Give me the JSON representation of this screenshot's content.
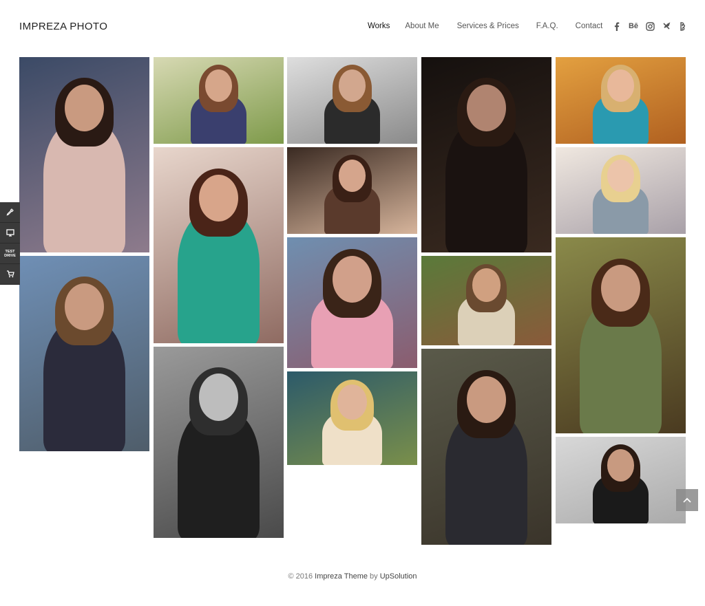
{
  "header": {
    "logo": "IMPREZA PHOTO",
    "nav": [
      {
        "label": "Works",
        "active": true
      },
      {
        "label": "About Me",
        "active": false
      },
      {
        "label": "Services & Prices",
        "active": false
      },
      {
        "label": "F.A.Q.",
        "active": false
      },
      {
        "label": "Contact",
        "active": false
      }
    ],
    "socials": [
      "facebook-icon",
      "behance-icon",
      "instagram-icon",
      "tripadvisor-icon",
      "vk-icon"
    ],
    "behance_text": "Bē"
  },
  "side_panel": {
    "items": [
      "eyedropper-icon",
      "monitor-icon",
      "test-drive-label",
      "cart-icon"
    ],
    "test_drive_line1": "TEST",
    "test_drive_line2": "DRIVE"
  },
  "gallery": {
    "tiles": [
      {
        "name": "portrait-woman-dark-hair-dress",
        "col": 0,
        "bg": [
          "#3b4a66",
          "#8e7b8c"
        ],
        "skin": "#c99a80",
        "hair": "#2a1a14",
        "cloth": "#d8b8b0"
      },
      {
        "name": "woman-city-skyscraper",
        "col": 0,
        "bg": [
          "#6f8fb5",
          "#4f5d6a"
        ],
        "skin": "#c99a80",
        "hair": "#6b4a2e",
        "cloth": "#2b2b3b"
      },
      {
        "name": "woman-polka-dress-garden",
        "col": 1,
        "bg": [
          "#d7d9b3",
          "#7e9a4a"
        ],
        "skin": "#d6a68a",
        "hair": "#7a4a30",
        "cloth": "#3a3f6e"
      },
      {
        "name": "woman-teal-jacket",
        "col": 1,
        "bg": [
          "#e8d6cc",
          "#8f6b62"
        ],
        "skin": "#d8a58a",
        "hair": "#4a2418",
        "cloth": "#27a38c"
      },
      {
        "name": "woman-bw-polka-dress",
        "col": 1,
        "bg": [
          "#9a9a9a",
          "#4a4a4a"
        ],
        "skin": "#bdbdbd",
        "hair": "#2e2e2e",
        "cloth": "#1f1f1f"
      },
      {
        "name": "woman-short-hair-closeup",
        "col": 2,
        "bg": [
          "#dedede",
          "#8a8a8a"
        ],
        "skin": "#d2a78e",
        "hair": "#8a5a34",
        "cloth": "#2b2b2b"
      },
      {
        "name": "woman-lollipop-closeup",
        "col": 2,
        "bg": [
          "#3a2a22",
          "#d7b59c"
        ],
        "skin": "#d5a58c",
        "hair": "#3a2016",
        "cloth": "#5a3a2c"
      },
      {
        "name": "woman-striped-shirt-graffiti",
        "col": 2,
        "bg": [
          "#6f8fb0",
          "#8b5c6e"
        ],
        "skin": "#d1a08a",
        "hair": "#3a2418",
        "cloth": "#e8a0b4"
      },
      {
        "name": "woman-blonde-meadow",
        "col": 2,
        "bg": [
          "#2c5a6a",
          "#7a8f4a"
        ],
        "skin": "#e0b49a",
        "hair": "#e0c070",
        "cloth": "#efe0c8"
      },
      {
        "name": "woman-portrait-dark-vintage",
        "col": 3,
        "bg": [
          "#15100e",
          "#3a2a20"
        ],
        "skin": "#b08470",
        "hair": "#2a1a12",
        "cloth": "#1a1210"
      },
      {
        "name": "woman-bridge-lake",
        "col": 3,
        "bg": [
          "#5a7a3a",
          "#8a5a3a"
        ],
        "skin": "#d0a080",
        "hair": "#6a4a30",
        "cloth": "#dcd0b8"
      },
      {
        "name": "woman-motorcycle",
        "col": 3,
        "bg": [
          "#5a5a4a",
          "#3a342a"
        ],
        "skin": "#c99a80",
        "hair": "#2a1a12",
        "cloth": "#2a2a30"
      },
      {
        "name": "woman-blonde-lollipop-orange",
        "col": 4,
        "bg": [
          "#e3a040",
          "#b06020"
        ],
        "skin": "#e8b89a",
        "hair": "#d8b070",
        "cloth": "#2a9ab0"
      },
      {
        "name": "woman-blonde-lollipop-white",
        "col": 4,
        "bg": [
          "#f0e8e0",
          "#a8a0a8"
        ],
        "skin": "#ecc4aa",
        "hair": "#e8d090",
        "cloth": "#8a9aa8"
      },
      {
        "name": "woman-tree-branch-lake",
        "col": 4,
        "bg": [
          "#8a8a4a",
          "#4a3a20"
        ],
        "skin": "#c99a80",
        "hair": "#4a2a18",
        "cloth": "#6a7a4a"
      },
      {
        "name": "man-portrait",
        "col": 4,
        "bg": [
          "#d8d8d8",
          "#aaaaaa"
        ],
        "skin": "#c89a80",
        "hair": "#2a1a12",
        "cloth": "#1a1a1a"
      }
    ]
  },
  "footer": {
    "prefix": "© 2016 ",
    "theme": "Impreza Theme",
    "by": " by ",
    "author": "UpSolution"
  }
}
